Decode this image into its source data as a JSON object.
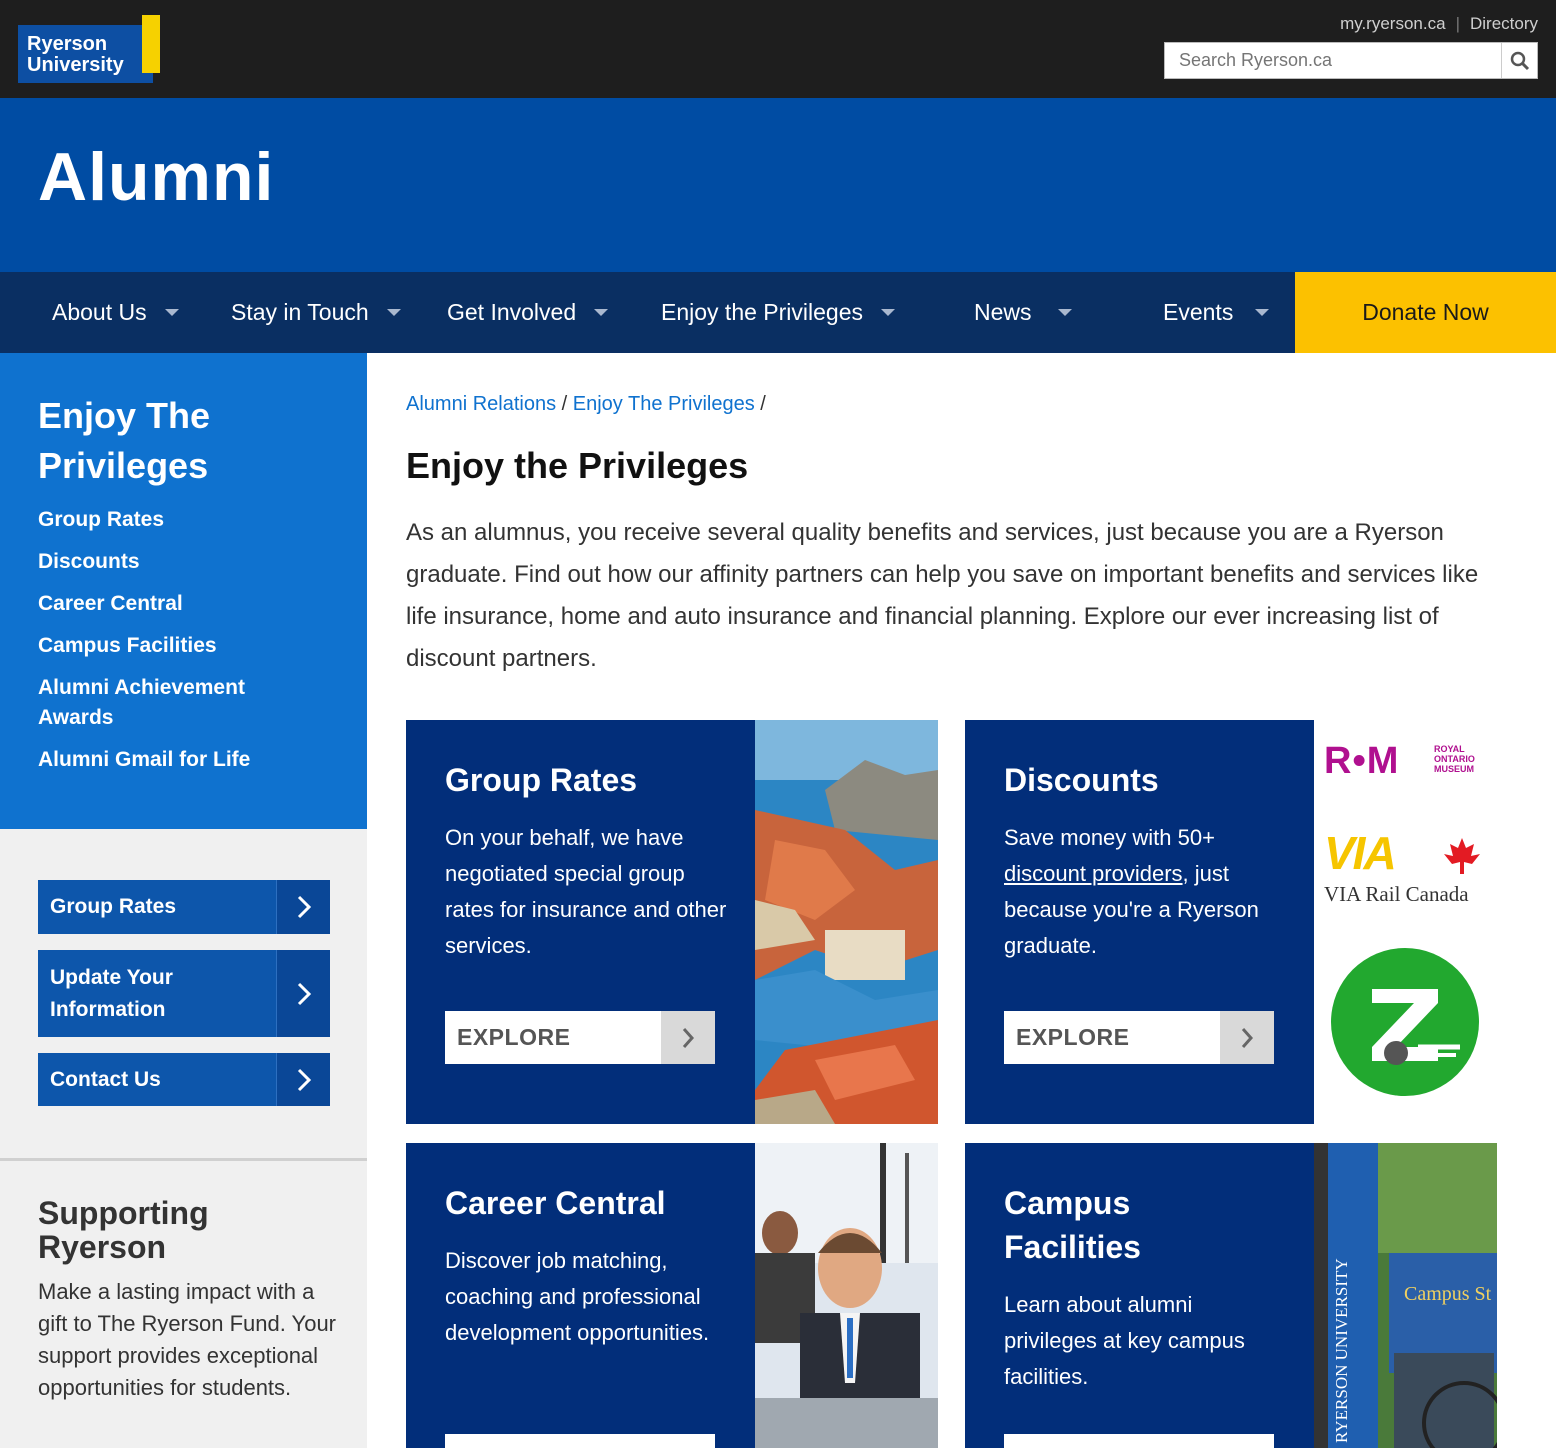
{
  "logo": {
    "line1": "Ryerson",
    "line2": "University"
  },
  "utility": {
    "link1": "my.ryerson.ca",
    "link2": "Directory",
    "search_placeholder": "Search Ryerson.ca"
  },
  "banner": {
    "title": "Alumni"
  },
  "nav": {
    "items": [
      {
        "label": "About Us"
      },
      {
        "label": "Stay in Touch"
      },
      {
        "label": "Get Involved"
      },
      {
        "label": "Enjoy the Privileges"
      },
      {
        "label": "News"
      },
      {
        "label": "Events"
      }
    ],
    "donate": "Donate Now"
  },
  "sidebar": {
    "section_title": "Enjoy The Privileges",
    "links": [
      "Group Rates",
      "Discounts",
      "Career Central",
      "Campus Facilities",
      "Alumni Achievement Awards",
      "Alumni Gmail for Life"
    ],
    "buttons": [
      "Group Rates",
      "Update Your Information",
      "Contact Us"
    ],
    "support_title": "Supporting Ryerson",
    "support_text": "Make a lasting impact with a gift to The Ryerson Fund. Your support provides exceptional opportunities for students."
  },
  "breadcrumb": {
    "crumb1": "Alumni Relations",
    "crumb2": "Enjoy The Privileges",
    "sep": "/"
  },
  "page": {
    "title": "Enjoy the Privileges",
    "intro": "As an alumnus, you receive several quality benefits and services, just because you are a Ryerson graduate. Find out how our affinity partners can help you save on important benefits and services like life insurance, home and auto insurance and financial planning. Explore our ever increasing list of discount partners."
  },
  "cards": {
    "group_rates": {
      "title": "Group Rates",
      "desc": "On your behalf, we have negotiated special group rates for insurance and other services.",
      "button": "EXPLORE"
    },
    "discounts": {
      "title": "Discounts",
      "desc_pre": "Save money with 50+ ",
      "desc_link": "discount providers",
      "desc_post": ", just because you're a Ryerson graduate.",
      "button": "EXPLORE"
    },
    "career": {
      "title": "Career Central",
      "desc": "Discover job matching, coaching and professional development opportunities."
    },
    "campus": {
      "title": "Campus Facilities",
      "desc": "Learn about alumni privileges at key campus facilities."
    }
  },
  "partners": {
    "rom_mark": "R•M",
    "rom_text": "ROYAL ONTARIO MUSEUM",
    "via_mark": "VIA",
    "via_text": "VIA Rail Canada"
  },
  "photo_text": {
    "banner": "RYERSON UNIVERSITY",
    "sign": "Campus St"
  },
  "colors": {
    "topbar": "#1e1e1e",
    "banner": "#004ca3",
    "nav": "#0a2f62",
    "donate": "#fcc100",
    "sidebar_blue": "#0f72cf",
    "card": "#022e7a",
    "link": "#0f72cf"
  }
}
